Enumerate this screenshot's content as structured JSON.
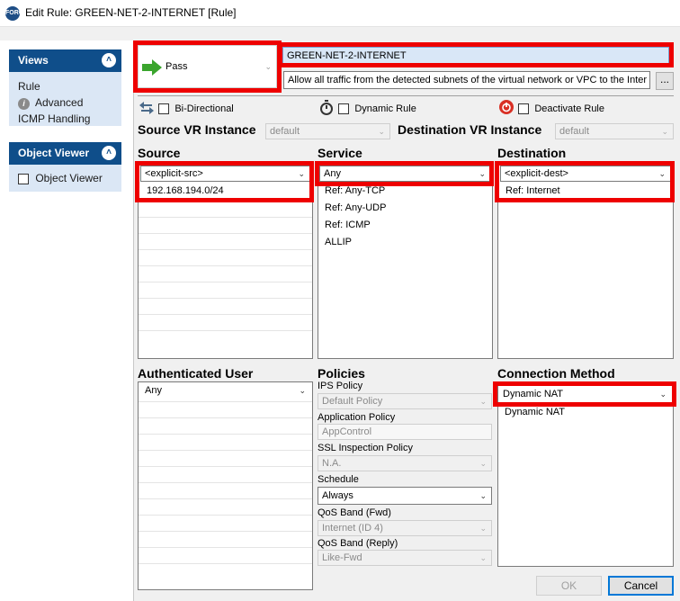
{
  "window": {
    "title": "Edit Rule: GREEN-NET-2-INTERNET [Rule]",
    "app_icon_text": "FORC"
  },
  "left_pane": {
    "views": {
      "title": "Views",
      "items": [
        "Rule",
        "Advanced",
        "ICMP Handling"
      ]
    },
    "object_viewer": {
      "title": "Object Viewer",
      "checkbox_label": "Object Viewer"
    }
  },
  "rule": {
    "action": "Pass",
    "name": "GREEN-NET-2-INTERNET",
    "description": "Allow all traffic from the detected subnets of the virtual network or VPC to the Inter",
    "more_button": "...",
    "bi_directional": "Bi-Directional",
    "dynamic_rule": "Dynamic Rule",
    "deactivate_rule": "Deactivate Rule",
    "source_vr_label": "Source VR Instance",
    "source_vr_value": "default",
    "dest_vr_label": "Destination VR Instance",
    "dest_vr_value": "default"
  },
  "source": {
    "header": "Source",
    "selector": "<explicit-src>",
    "items": [
      "192.168.194.0/24"
    ]
  },
  "service": {
    "header": "Service",
    "selector": "Any",
    "items": [
      "Ref: Any-TCP",
      "Ref: Any-UDP",
      "Ref: ICMP",
      "ALLIP"
    ]
  },
  "destination": {
    "header": "Destination",
    "selector": "<explicit-dest>",
    "items": [
      "Ref: Internet"
    ]
  },
  "auth_user": {
    "header": "Authenticated User",
    "selector": "Any"
  },
  "policies": {
    "header": "Policies",
    "ips_label": "IPS Policy",
    "ips_value": "Default Policy",
    "app_label": "Application Policy",
    "app_value": "AppControl",
    "ssl_label": "SSL Inspection Policy",
    "ssl_value": "N.A.",
    "schedule_label": "Schedule",
    "schedule_value": "Always",
    "qos_fwd_label": "QoS Band (Fwd)",
    "qos_fwd_value": "Internet (ID 4)",
    "qos_reply_label": "QoS Band (Reply)",
    "qos_reply_value": "Like-Fwd"
  },
  "connection": {
    "header": "Connection Method",
    "selector": "Dynamic NAT",
    "items": [
      "Dynamic NAT"
    ]
  },
  "buttons": {
    "ok": "OK",
    "cancel": "Cancel"
  },
  "colors": {
    "highlight": "#ee0000",
    "left_header": "#0f4e8a",
    "left_body": "#dbe7f5",
    "pass_arrow": "#3aa52d",
    "deactivate_icon": "#d93025"
  }
}
